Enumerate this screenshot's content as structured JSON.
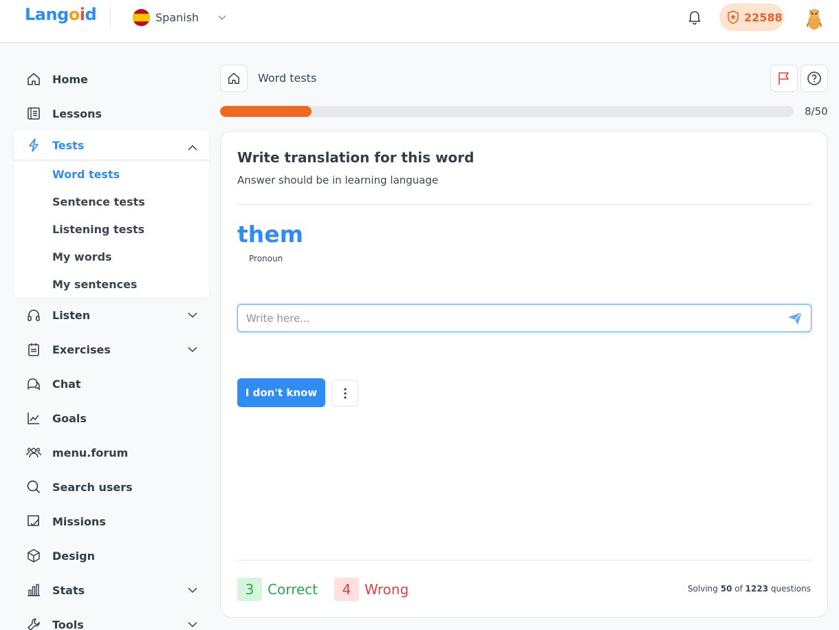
{
  "header": {
    "logo": {
      "a": "Lang",
      "o": "o",
      "i": "i",
      "d": "d"
    },
    "language": "Spanish",
    "points": "22588"
  },
  "sidebar": {
    "items": [
      {
        "label": "Home",
        "icon": "home-icon"
      },
      {
        "label": "Lessons",
        "icon": "book-icon"
      },
      {
        "label": "Tests",
        "icon": "lightning-icon",
        "expanded": true
      },
      {
        "label": "Listen",
        "icon": "headphones-icon"
      },
      {
        "label": "Exercises",
        "icon": "notepad-icon"
      },
      {
        "label": "Chat",
        "icon": "chat-icon"
      },
      {
        "label": "Goals",
        "icon": "chart-line-icon"
      },
      {
        "label": "menu.forum",
        "icon": "users-icon"
      },
      {
        "label": "Search users",
        "icon": "search-icon"
      },
      {
        "label": "Missions",
        "icon": "checklist-icon"
      },
      {
        "label": "Design",
        "icon": "cube-icon"
      },
      {
        "label": "Stats",
        "icon": "bar-chart-icon"
      },
      {
        "label": "Tools",
        "icon": "wrench-icon"
      }
    ],
    "tests_sub": [
      "Word tests",
      "Sentence tests",
      "Listening tests",
      "My words",
      "My sentences"
    ]
  },
  "main": {
    "breadcrumb": "Word tests",
    "progress": {
      "current": 8,
      "total": 50,
      "text": "8/50",
      "fraction": 0.16
    },
    "question": {
      "title": "Write translation for this word",
      "subtitle": "Answer should be in learning language",
      "word": "them",
      "part_of_speech": "Pronoun"
    },
    "answer_placeholder": "Write here...",
    "dont_know_label": "I don't know",
    "score": {
      "correct": "3",
      "correct_label": "Correct",
      "wrong": "4",
      "wrong_label": "Wrong"
    },
    "solving": {
      "prefix": "Solving",
      "current": "50",
      "of": "of",
      "total": "1223",
      "suffix": "questions"
    }
  },
  "colors": {
    "accent": "#2f8cf1",
    "progress": "#ee6a22",
    "correct": "#27a94a",
    "wrong": "#e5413a",
    "points_bg": "#fde3d0"
  }
}
